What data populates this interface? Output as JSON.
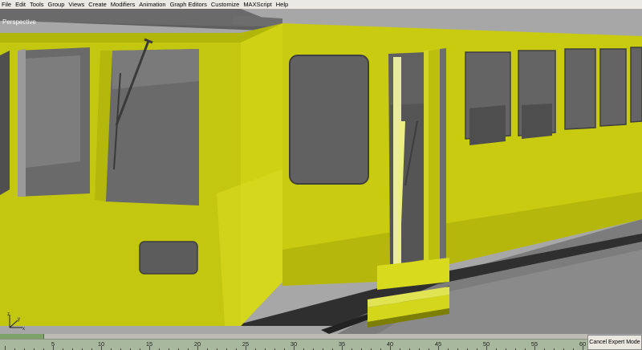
{
  "menu": [
    "File",
    "Edit",
    "Tools",
    "Group",
    "Views",
    "Create",
    "Modifiers",
    "Animation",
    "Graph Editors",
    "Customize",
    "MAXScript",
    "Help"
  ],
  "viewport": {
    "label": "Perspective"
  },
  "axis": {
    "x": "x",
    "y": "y",
    "z": "z"
  },
  "timeline": {
    "frame_labels": [
      "5",
      "10",
      "15",
      "20",
      "25",
      "30",
      "35",
      "40",
      "45",
      "50",
      "55",
      "60"
    ],
    "current_frame_fraction": 0.0
  },
  "expert_button": {
    "label": "Cancel Expert Mode"
  },
  "colors": {
    "train_yellow": "#c9cc0f",
    "background": "#a7a7a7",
    "glass": "#686868",
    "floor": "#7f7f7f"
  }
}
